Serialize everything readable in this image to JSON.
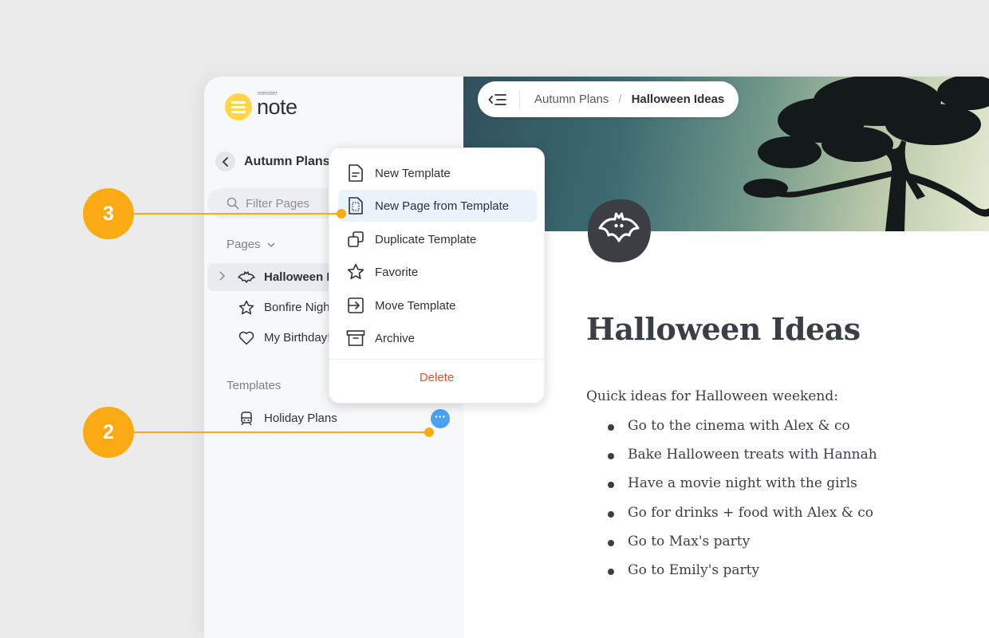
{
  "app": {
    "logo_small": "meister",
    "logo_text": "note"
  },
  "sidebar": {
    "back_title": "Autumn Plans",
    "filter_placeholder": "Filter Pages",
    "pages_label": "Pages",
    "pages": [
      {
        "label": "Halloween I",
        "icon": "bat-icon",
        "active": true
      },
      {
        "label": "Bonfire Nigh",
        "icon": "star-icon"
      },
      {
        "label": "My Birthday!",
        "icon": "heart-icon"
      }
    ],
    "templates_label": "Templates",
    "templates": [
      {
        "label": "Holiday Plans",
        "icon": "train-icon"
      }
    ]
  },
  "breadcrumb": {
    "parent": "Autumn Plans",
    "separator": "/",
    "current": "Halloween Ideas"
  },
  "page": {
    "title": "Halloween Ideas",
    "intro": "Quick ideas for Halloween weekend:",
    "items": [
      "Go to the cinema with Alex & co",
      "Bake Halloween treats with Hannah",
      "Have a movie night with the girls",
      "Go for drinks + food with Alex & co",
      "Go to Max's party",
      "Go to Emily's party"
    ]
  },
  "context_menu": {
    "items": [
      {
        "label": "New Template",
        "icon": "document-icon"
      },
      {
        "label": "New Page from Template",
        "icon": "template-page-icon",
        "highlighted": true
      },
      {
        "label": "Duplicate Template",
        "icon": "duplicate-icon"
      },
      {
        "label": "Favorite",
        "icon": "star-icon"
      },
      {
        "label": "Move Template",
        "icon": "move-icon"
      },
      {
        "label": "Archive",
        "icon": "archive-icon"
      }
    ],
    "delete_label": "Delete"
  },
  "steps": [
    {
      "number": "3"
    },
    {
      "number": "2"
    }
  ],
  "colors": {
    "accent": "#fbab12",
    "highlight": "#e8f3fc",
    "delete": "#e2532d",
    "more_button": "#4aa3f0"
  }
}
